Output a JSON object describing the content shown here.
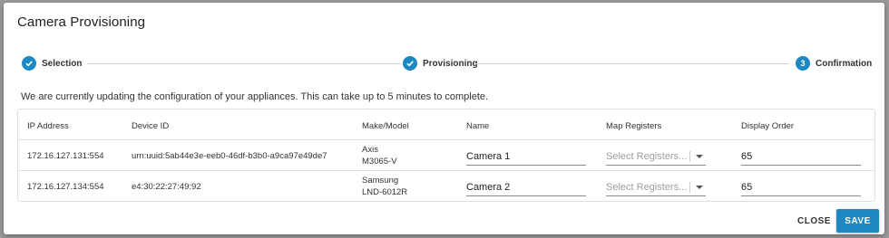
{
  "dialog": {
    "title": "Camera Provisioning",
    "status_text": "We are currently updating the configuration of your appliances. This can take up to 5 minutes to complete."
  },
  "stepper": {
    "steps": [
      {
        "label": "Selection",
        "state": "complete",
        "icon": "check-icon"
      },
      {
        "label": "Provisioning",
        "state": "complete",
        "icon": "check-icon"
      },
      {
        "label": "Confirmation",
        "state": "active",
        "number": "3"
      }
    ]
  },
  "table": {
    "columns": [
      "IP Address",
      "Device ID",
      "Make/Model",
      "Name",
      "Map Registers",
      "Display Order"
    ],
    "rows": [
      {
        "ip": "172.16.127.131:554",
        "device_id": "urn:uuid:5ab44e3e-eeb0-46df-b3b0-a9ca97e49de7",
        "make": "Axis",
        "model": "M3065-V",
        "name": "Camera 1",
        "registers_placeholder": "Select Registers...",
        "display_order": "65"
      },
      {
        "ip": "172.16.127.134:554",
        "device_id": "e4:30:22:27:49:92",
        "make": "Samsung",
        "model": "LND-6012R",
        "name": "Camera 2",
        "registers_placeholder": "Select Registers...",
        "display_order": "65"
      }
    ]
  },
  "footer": {
    "close_label": "CLOSE",
    "save_label": "SAVE"
  },
  "colors": {
    "accent": "#1e88c5"
  }
}
